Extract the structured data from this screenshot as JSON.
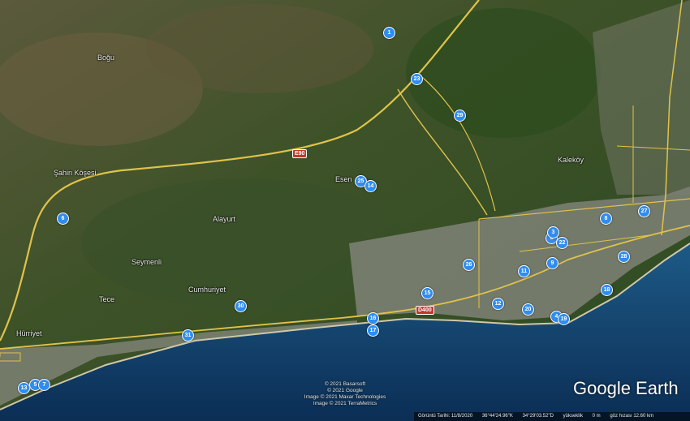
{
  "map": {
    "places": [
      {
        "name": "Boğu"
      },
      {
        "name": "Şahin Köşesi"
      },
      {
        "name": "Esen"
      },
      {
        "name": "Kaleköy"
      },
      {
        "name": "Alayurt"
      },
      {
        "name": "Seymenli"
      },
      {
        "name": "Cumhuriyet"
      },
      {
        "name": "Tece"
      },
      {
        "name": "Hürriyet"
      }
    ],
    "road_labels": [
      "E90",
      "D400"
    ],
    "markers": [
      "1",
      "23",
      "29",
      "25",
      "14",
      "6",
      "8",
      "27",
      "2",
      "22",
      "28",
      "26",
      "11",
      "9",
      "15",
      "12",
      "20",
      "4",
      "19",
      "30",
      "16",
      "17",
      "31",
      "13",
      "5",
      "7",
      "18",
      "3"
    ]
  },
  "credits": [
    "© 2021 Basarsoft",
    "© 2021 Google",
    "Image © 2021 Maxar Technologies",
    "Image © 2021 TerraMetrics"
  ],
  "logo": "Google Earth",
  "status": {
    "date": "Görüntü Tarihi: 11/8/2020",
    "lat": "36°44'24.96\"K",
    "lon": "34°29'03.52\"D",
    "elev_label": "yükseklik",
    "elev": "0 m",
    "eye": "göz hızası  12.60 km"
  }
}
